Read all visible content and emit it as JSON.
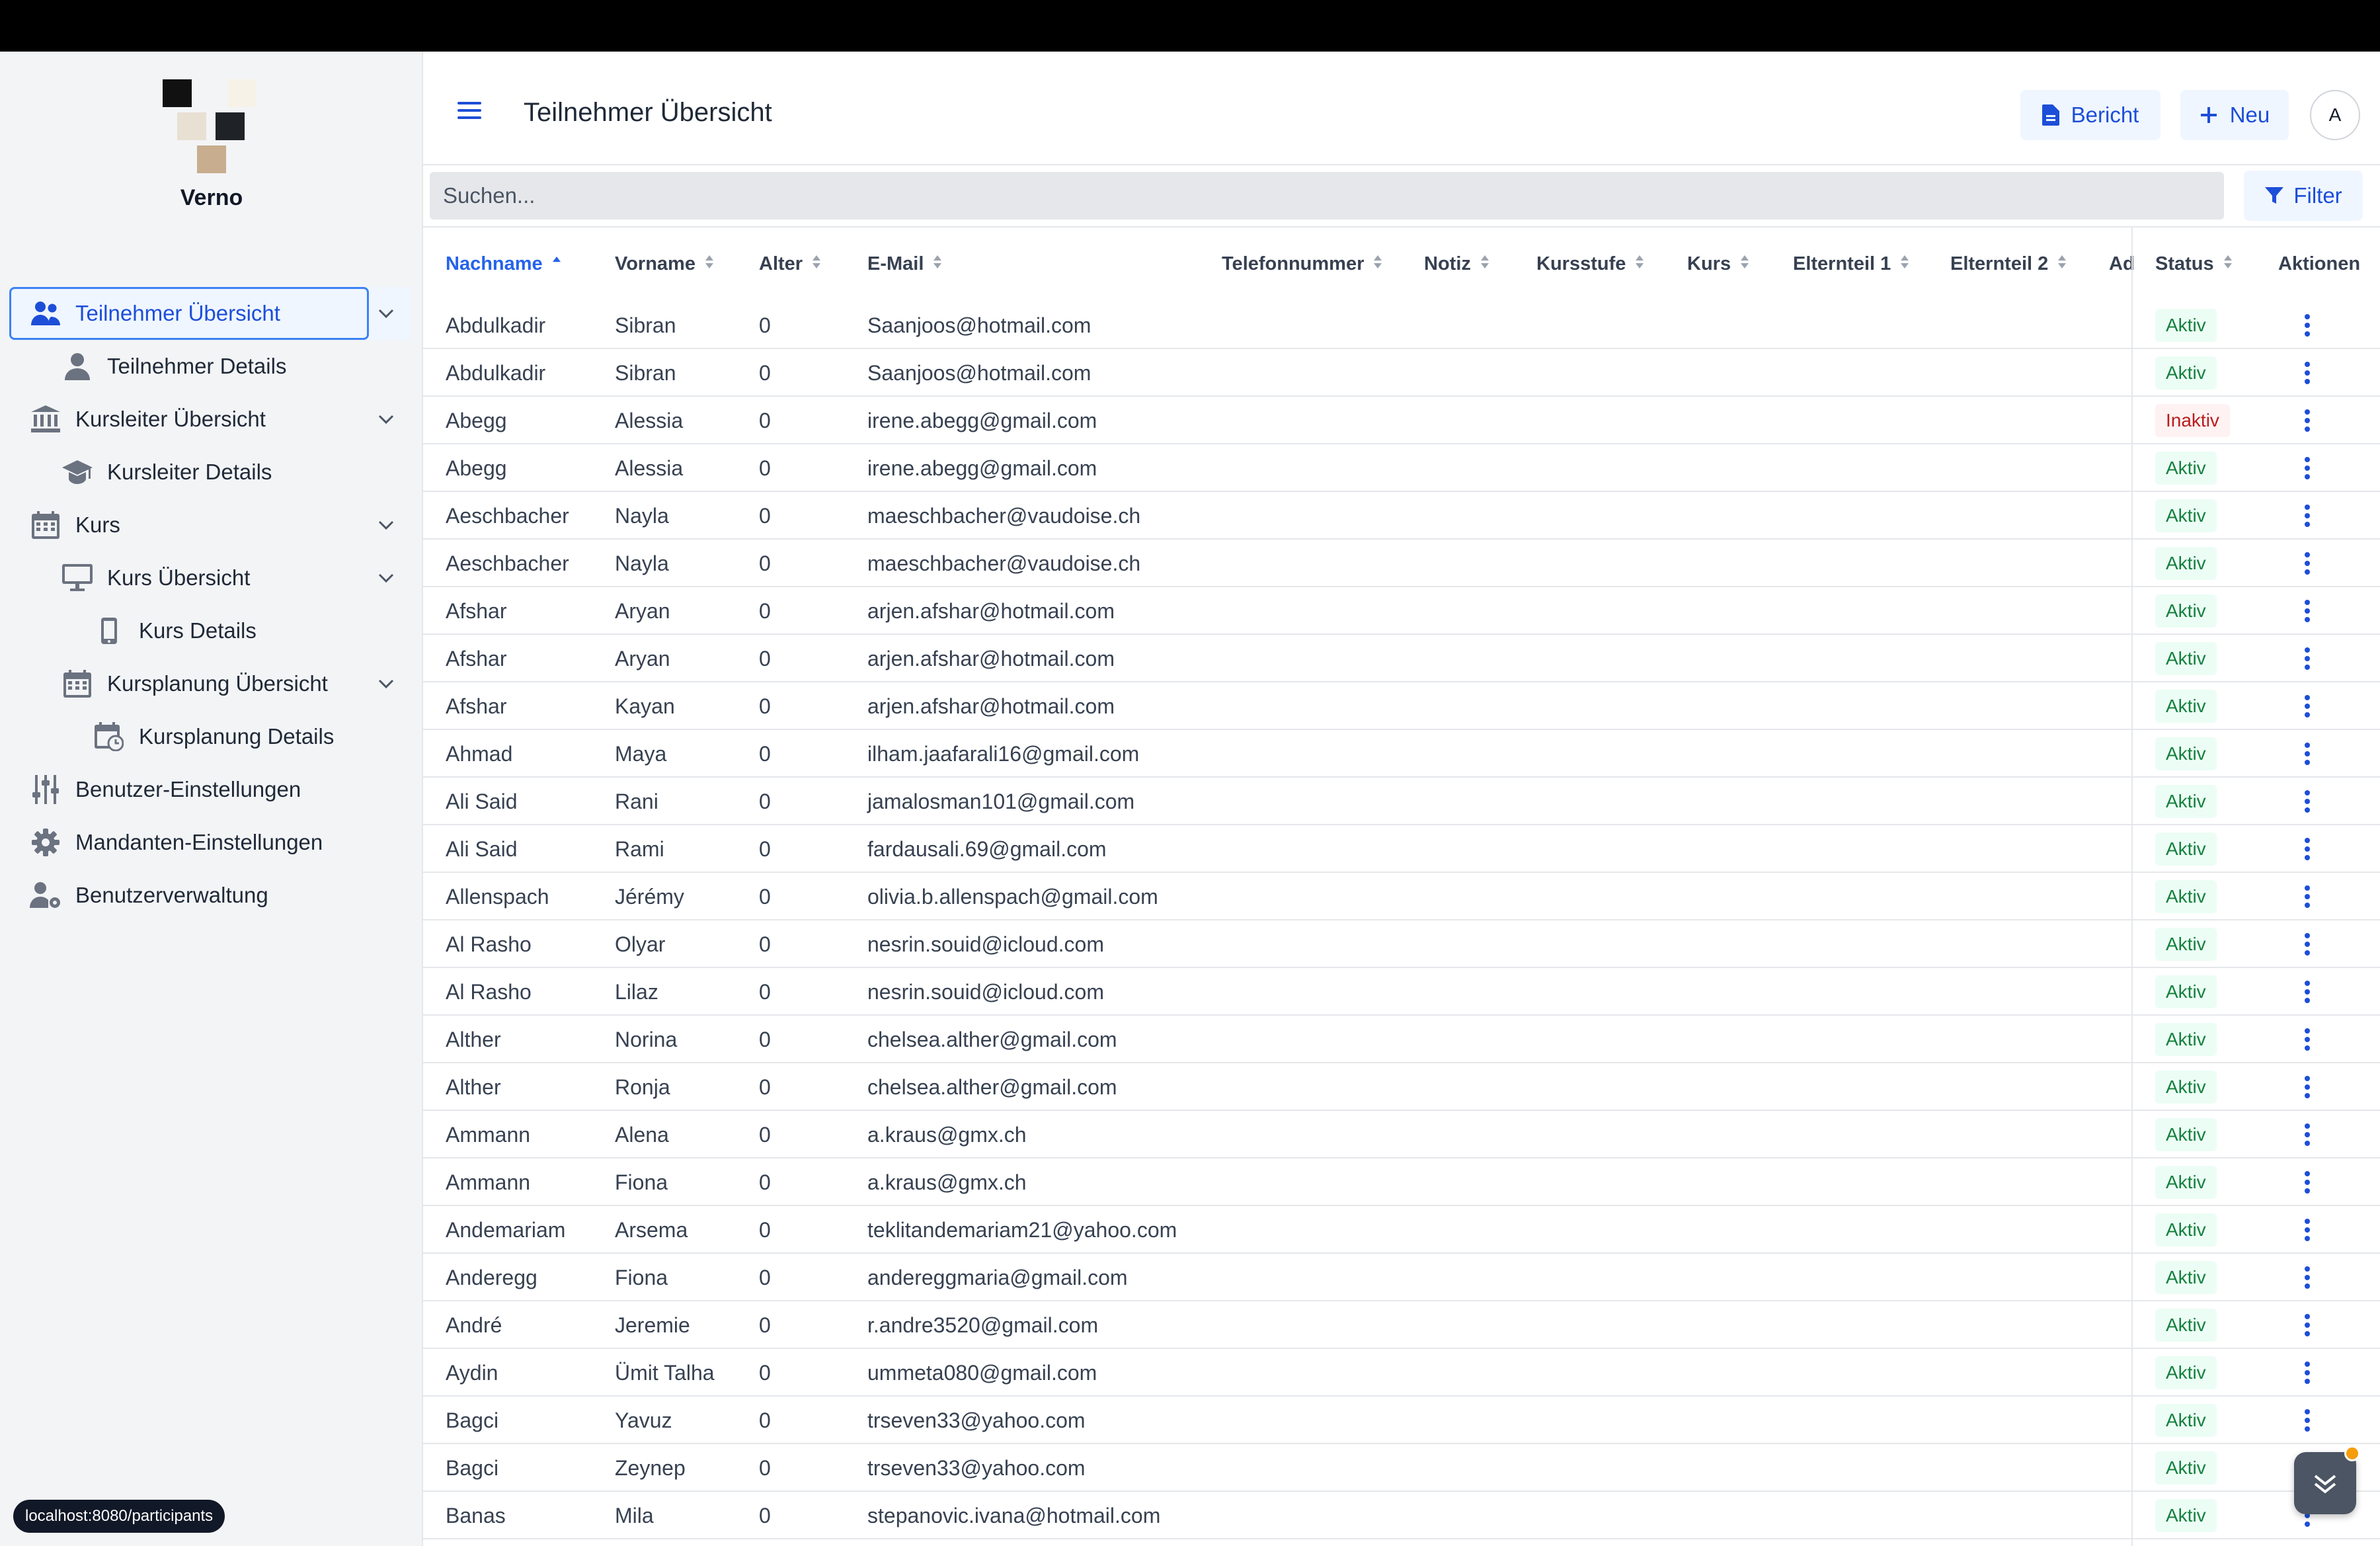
{
  "app": {
    "brand": "Verno",
    "page_title": "Teilnehmer Übersicht"
  },
  "colors": {
    "accent": "#1d4ed8",
    "active_badge": "#15803d",
    "inactive_badge": "#b91c1c"
  },
  "sidebar": {
    "items": [
      {
        "label": "Teilnehmer Übersicht",
        "icon": "users-icon",
        "active": true,
        "chevron": true
      },
      {
        "label": "Teilnehmer Details",
        "icon": "user-icon",
        "active": false,
        "chevron": false
      },
      {
        "label": "Kursleiter Übersicht",
        "icon": "bank-icon",
        "active": false,
        "chevron": true
      },
      {
        "label": "Kursleiter Details",
        "icon": "graduation-cap-icon",
        "active": false,
        "chevron": false
      },
      {
        "label": "Kurs",
        "icon": "calendar-icon",
        "active": false,
        "chevron": true
      },
      {
        "label": "Kurs Übersicht",
        "icon": "monitor-icon",
        "active": false,
        "chevron": true
      },
      {
        "label": "Kurs Details",
        "icon": "mobile-icon",
        "active": false,
        "chevron": false
      },
      {
        "label": "Kursplanung Übersicht",
        "icon": "calendar-icon",
        "active": false,
        "chevron": true
      },
      {
        "label": "Kursplanung Details",
        "icon": "calendar-clock-icon",
        "active": false,
        "chevron": false
      },
      {
        "label": "Benutzer-Einstellungen",
        "icon": "sliders-icon",
        "active": false,
        "chevron": false
      },
      {
        "label": "Mandanten-Einstellungen",
        "icon": "gear-icon",
        "active": false,
        "chevron": false
      },
      {
        "label": "Benutzerverwaltung",
        "icon": "user-gear-icon",
        "active": false,
        "chevron": false
      }
    ]
  },
  "header": {
    "report_label": "Bericht",
    "new_label": "Neu",
    "avatar_initial": "A"
  },
  "search": {
    "placeholder": "Suchen...",
    "value": ""
  },
  "filter_label": "Filter",
  "table": {
    "columns": [
      "Nachname",
      "Vorname",
      "Alter",
      "E-Mail",
      "Telefonnummer",
      "Notiz",
      "Kursstufe",
      "Kurs",
      "Elternteil 1",
      "Elternteil 2",
      "Ad",
      "Status",
      "Aktionen"
    ],
    "sorted_column": "Nachname",
    "rows": [
      {
        "nachname": "Abdulkadir",
        "vorname": "Sibran",
        "alter": "0",
        "email": "Saanjoos@hotmail.com",
        "status": "Aktiv"
      },
      {
        "nachname": "Abdulkadir",
        "vorname": "Sibran",
        "alter": "0",
        "email": "Saanjoos@hotmail.com",
        "status": "Aktiv"
      },
      {
        "nachname": "Abegg",
        "vorname": "Alessia",
        "alter": "0",
        "email": "irene.abegg@gmail.com",
        "status": "Inaktiv"
      },
      {
        "nachname": "Abegg",
        "vorname": "Alessia",
        "alter": "0",
        "email": "irene.abegg@gmail.com",
        "status": "Aktiv"
      },
      {
        "nachname": "Aeschbacher",
        "vorname": "Nayla",
        "alter": "0",
        "email": "maeschbacher@vaudoise.ch",
        "status": "Aktiv"
      },
      {
        "nachname": "Aeschbacher",
        "vorname": "Nayla",
        "alter": "0",
        "email": "maeschbacher@vaudoise.ch",
        "status": "Aktiv"
      },
      {
        "nachname": "Afshar",
        "vorname": "Aryan",
        "alter": "0",
        "email": "arjen.afshar@hotmail.com",
        "status": "Aktiv"
      },
      {
        "nachname": "Afshar",
        "vorname": "Aryan",
        "alter": "0",
        "email": "arjen.afshar@hotmail.com",
        "status": "Aktiv"
      },
      {
        "nachname": "Afshar",
        "vorname": "Kayan",
        "alter": "0",
        "email": "arjen.afshar@hotmail.com",
        "status": "Aktiv"
      },
      {
        "nachname": "Ahmad",
        "vorname": "Maya",
        "alter": "0",
        "email": "ilham.jaafarali16@gmail.com",
        "status": "Aktiv"
      },
      {
        "nachname": "Ali Said",
        "vorname": "Rani",
        "alter": "0",
        "email": "jamalosman101@gmail.com",
        "status": "Aktiv"
      },
      {
        "nachname": "Ali Said",
        "vorname": "Rami",
        "alter": "0",
        "email": "fardausali.69@gmail.com",
        "status": "Aktiv"
      },
      {
        "nachname": "Allenspach",
        "vorname": "Jérémy",
        "alter": "0",
        "email": "olivia.b.allenspach@gmail.com",
        "status": "Aktiv"
      },
      {
        "nachname": "Al Rasho",
        "vorname": "Olyar",
        "alter": "0",
        "email": "nesrin.souid@icloud.com",
        "status": "Aktiv"
      },
      {
        "nachname": "Al Rasho",
        "vorname": "Lilaz",
        "alter": "0",
        "email": "nesrin.souid@icloud.com",
        "status": "Aktiv"
      },
      {
        "nachname": "Alther",
        "vorname": "Norina",
        "alter": "0",
        "email": "chelsea.alther@gmail.com",
        "status": "Aktiv"
      },
      {
        "nachname": "Alther",
        "vorname": "Ronja",
        "alter": "0",
        "email": "chelsea.alther@gmail.com",
        "status": "Aktiv"
      },
      {
        "nachname": "Ammann",
        "vorname": "Alena",
        "alter": "0",
        "email": "a.kraus@gmx.ch",
        "status": "Aktiv"
      },
      {
        "nachname": "Ammann",
        "vorname": "Fiona",
        "alter": "0",
        "email": "a.kraus@gmx.ch",
        "status": "Aktiv"
      },
      {
        "nachname": "Andemariam",
        "vorname": "Arsema",
        "alter": "0",
        "email": "teklitandemariam21@yahoo.com",
        "status": "Aktiv"
      },
      {
        "nachname": "Anderegg",
        "vorname": "Fiona",
        "alter": "0",
        "email": "andereggmaria@gmail.com",
        "status": "Aktiv"
      },
      {
        "nachname": "André",
        "vorname": "Jeremie",
        "alter": "0",
        "email": "r.andre3520@gmail.com",
        "status": "Aktiv"
      },
      {
        "nachname": "Aydin",
        "vorname": "Ümit Talha",
        "alter": "0",
        "email": "ummeta080@gmail.com",
        "status": "Aktiv"
      },
      {
        "nachname": "Bagci",
        "vorname": "Yavuz",
        "alter": "0",
        "email": "trseven33@yahoo.com",
        "status": "Aktiv"
      },
      {
        "nachname": "Bagci",
        "vorname": "Zeynep",
        "alter": "0",
        "email": "trseven33@yahoo.com",
        "status": "Aktiv"
      },
      {
        "nachname": "Banas",
        "vorname": "Mila",
        "alter": "0",
        "email": "stepanovic.ivana@hotmail.com",
        "status": "Aktiv"
      }
    ]
  },
  "status_bar": {
    "url": "localhost:8080/participants"
  }
}
